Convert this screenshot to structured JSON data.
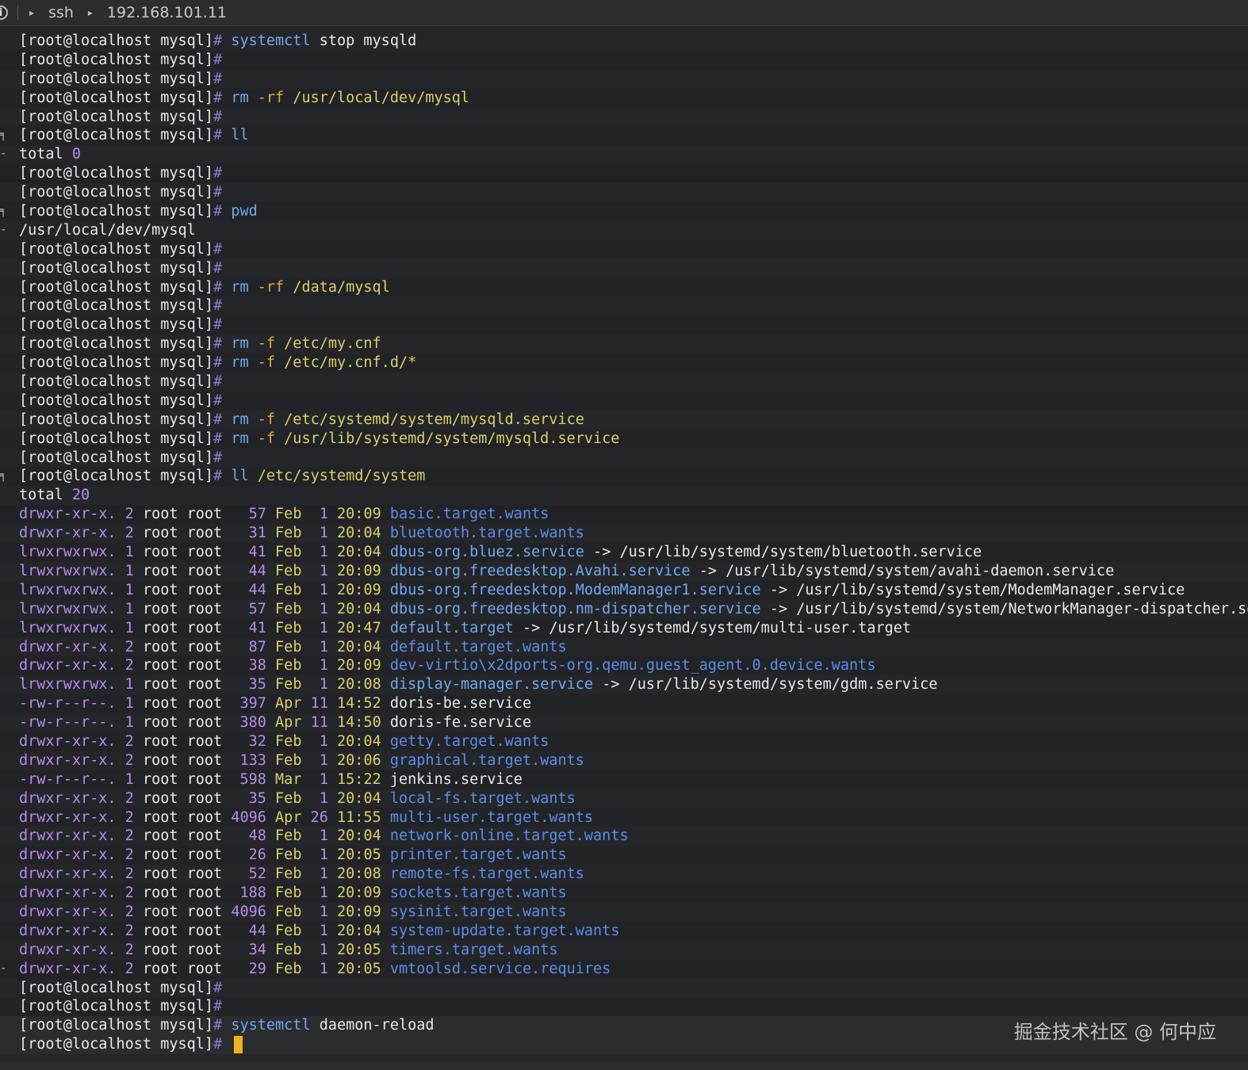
{
  "titlebar": {
    "arrow1": "▸",
    "item1": "ssh",
    "arrow2": "▸",
    "item2": "192.168.101.11"
  },
  "prompt": "[root@localhost mysql]",
  "hash": "#",
  "lines": [
    {
      "type": "cmd",
      "parts": [
        [
          "cmd",
          "systemctl"
        ],
        [
          "arg",
          " stop mysqld"
        ]
      ]
    },
    {
      "type": "cmd",
      "parts": []
    },
    {
      "type": "cmd",
      "parts": []
    },
    {
      "type": "cmd",
      "parts": [
        [
          "cmd",
          "rm"
        ],
        [
          "flag",
          " -rf"
        ],
        [
          "path",
          " /usr/local/dev/mysql"
        ]
      ]
    },
    {
      "type": "cmd",
      "parts": []
    },
    {
      "type": "cmd",
      "gutter": "╕",
      "parts": [
        [
          "cmd",
          "ll"
        ]
      ]
    },
    {
      "type": "out",
      "gutter": "-",
      "parts": [
        [
          "arg",
          "total "
        ],
        [
          "num",
          "0"
        ]
      ]
    },
    {
      "type": "cmd",
      "parts": []
    },
    {
      "type": "cmd",
      "parts": []
    },
    {
      "type": "cmd",
      "gutter": "╕",
      "parts": [
        [
          "cmd",
          "pwd"
        ]
      ]
    },
    {
      "type": "out",
      "gutter": "-",
      "parts": [
        [
          "arg",
          "/usr/local/dev/mysql"
        ]
      ]
    },
    {
      "type": "cmd",
      "parts": []
    },
    {
      "type": "cmd",
      "parts": []
    },
    {
      "type": "cmd",
      "parts": [
        [
          "cmd",
          "rm"
        ],
        [
          "flag",
          " -rf"
        ],
        [
          "path",
          " /data/mysql"
        ]
      ]
    },
    {
      "type": "cmd",
      "parts": []
    },
    {
      "type": "cmd",
      "parts": []
    },
    {
      "type": "cmd",
      "parts": [
        [
          "cmd",
          "rm"
        ],
        [
          "flag",
          " -f"
        ],
        [
          "path",
          " /etc/my.cnf"
        ]
      ]
    },
    {
      "type": "cmd",
      "parts": [
        [
          "cmd",
          "rm"
        ],
        [
          "flag",
          " -f"
        ],
        [
          "path",
          " /etc/my.cnf.d/*"
        ]
      ]
    },
    {
      "type": "cmd",
      "parts": []
    },
    {
      "type": "cmd",
      "parts": []
    },
    {
      "type": "cmd",
      "parts": [
        [
          "cmd",
          "rm"
        ],
        [
          "flag",
          " -f"
        ],
        [
          "path",
          " /etc/systemd/system/mysqld.service"
        ]
      ]
    },
    {
      "type": "cmd",
      "parts": [
        [
          "cmd",
          "rm"
        ],
        [
          "flag",
          " -f"
        ],
        [
          "path",
          " /usr/lib/systemd/system/mysqld.service"
        ]
      ]
    },
    {
      "type": "cmd",
      "parts": []
    },
    {
      "type": "cmd",
      "gutter": "╕",
      "parts": [
        [
          "cmd",
          "ll"
        ],
        [
          "path",
          " /etc/systemd/system"
        ]
      ]
    },
    {
      "type": "out",
      "parts": [
        [
          "arg",
          "total "
        ],
        [
          "num",
          "20"
        ]
      ]
    }
  ],
  "listing": [
    {
      "perm": "drwxr-xr-x.",
      "links": "2",
      "user": "root",
      "group": "root",
      "size": "  57",
      "mon": "Feb",
      "day": " 1",
      "time": "20:09",
      "name": "basic.target.wants",
      "kind": "dir",
      "target": ""
    },
    {
      "perm": "drwxr-xr-x.",
      "links": "2",
      "user": "root",
      "group": "root",
      "size": "  31",
      "mon": "Feb",
      "day": " 1",
      "time": "20:04",
      "name": "bluetooth.target.wants",
      "kind": "dir",
      "target": ""
    },
    {
      "perm": "lrwxrwxrwx.",
      "links": "1",
      "user": "root",
      "group": "root",
      "size": "  41",
      "mon": "Feb",
      "day": " 1",
      "time": "20:04",
      "name": "dbus-org.bluez.service",
      "kind": "link",
      "target": "/usr/lib/systemd/system/bluetooth.service"
    },
    {
      "perm": "lrwxrwxrwx.",
      "links": "1",
      "user": "root",
      "group": "root",
      "size": "  44",
      "mon": "Feb",
      "day": " 1",
      "time": "20:09",
      "name": "dbus-org.freedesktop.Avahi.service",
      "kind": "link",
      "target": "/usr/lib/systemd/system/avahi-daemon.service"
    },
    {
      "perm": "lrwxrwxrwx.",
      "links": "1",
      "user": "root",
      "group": "root",
      "size": "  44",
      "mon": "Feb",
      "day": " 1",
      "time": "20:09",
      "name": "dbus-org.freedesktop.ModemManager1.service",
      "kind": "link",
      "target": "/usr/lib/systemd/system/ModemManager.service"
    },
    {
      "perm": "lrwxrwxrwx.",
      "links": "1",
      "user": "root",
      "group": "root",
      "size": "  57",
      "mon": "Feb",
      "day": " 1",
      "time": "20:04",
      "name": "dbus-org.freedesktop.nm-dispatcher.service",
      "kind": "link",
      "target": "/usr/lib/systemd/system/NetworkManager-dispatcher.service"
    },
    {
      "perm": "lrwxrwxrwx.",
      "links": "1",
      "user": "root",
      "group": "root",
      "size": "  41",
      "mon": "Feb",
      "day": " 1",
      "time": "20:47",
      "name": "default.target",
      "kind": "link",
      "target": "/usr/lib/systemd/system/multi-user.target"
    },
    {
      "perm": "drwxr-xr-x.",
      "links": "2",
      "user": "root",
      "group": "root",
      "size": "  87",
      "mon": "Feb",
      "day": " 1",
      "time": "20:04",
      "name": "default.target.wants",
      "kind": "dir",
      "target": ""
    },
    {
      "perm": "drwxr-xr-x.",
      "links": "2",
      "user": "root",
      "group": "root",
      "size": "  38",
      "mon": "Feb",
      "day": " 1",
      "time": "20:09",
      "name": "dev-virtio\\x2dports-org.qemu.guest_agent.0.device.wants",
      "kind": "dir",
      "target": ""
    },
    {
      "perm": "lrwxrwxrwx.",
      "links": "1",
      "user": "root",
      "group": "root",
      "size": "  35",
      "mon": "Feb",
      "day": " 1",
      "time": "20:08",
      "name": "display-manager.service",
      "kind": "link",
      "target": "/usr/lib/systemd/system/gdm.service"
    },
    {
      "perm": "-rw-r--r--.",
      "links": "1",
      "user": "root",
      "group": "root",
      "size": " 397",
      "mon": "Apr",
      "day": "11",
      "time": "14:52",
      "name": "doris-be.service",
      "kind": "file",
      "target": ""
    },
    {
      "perm": "-rw-r--r--.",
      "links": "1",
      "user": "root",
      "group": "root",
      "size": " 380",
      "mon": "Apr",
      "day": "11",
      "time": "14:50",
      "name": "doris-fe.service",
      "kind": "file",
      "target": ""
    },
    {
      "perm": "drwxr-xr-x.",
      "links": "2",
      "user": "root",
      "group": "root",
      "size": "  32",
      "mon": "Feb",
      "day": " 1",
      "time": "20:04",
      "name": "getty.target.wants",
      "kind": "dir",
      "target": ""
    },
    {
      "perm": "drwxr-xr-x.",
      "links": "2",
      "user": "root",
      "group": "root",
      "size": " 133",
      "mon": "Feb",
      "day": " 1",
      "time": "20:06",
      "name": "graphical.target.wants",
      "kind": "dir",
      "target": ""
    },
    {
      "perm": "-rw-r--r--.",
      "links": "1",
      "user": "root",
      "group": "root",
      "size": " 598",
      "mon": "Mar",
      "day": " 1",
      "time": "15:22",
      "name": "jenkins.service",
      "kind": "file",
      "target": ""
    },
    {
      "perm": "drwxr-xr-x.",
      "links": "2",
      "user": "root",
      "group": "root",
      "size": "  35",
      "mon": "Feb",
      "day": " 1",
      "time": "20:04",
      "name": "local-fs.target.wants",
      "kind": "dir",
      "target": ""
    },
    {
      "perm": "drwxr-xr-x.",
      "links": "2",
      "user": "root",
      "group": "root",
      "size": "4096",
      "mon": "Apr",
      "day": "26",
      "time": "11:55",
      "name": "multi-user.target.wants",
      "kind": "dir",
      "target": ""
    },
    {
      "perm": "drwxr-xr-x.",
      "links": "2",
      "user": "root",
      "group": "root",
      "size": "  48",
      "mon": "Feb",
      "day": " 1",
      "time": "20:04",
      "name": "network-online.target.wants",
      "kind": "dir",
      "target": ""
    },
    {
      "perm": "drwxr-xr-x.",
      "links": "2",
      "user": "root",
      "group": "root",
      "size": "  26",
      "mon": "Feb",
      "day": " 1",
      "time": "20:05",
      "name": "printer.target.wants",
      "kind": "dir",
      "target": ""
    },
    {
      "perm": "drwxr-xr-x.",
      "links": "2",
      "user": "root",
      "group": "root",
      "size": "  52",
      "mon": "Feb",
      "day": " 1",
      "time": "20:08",
      "name": "remote-fs.target.wants",
      "kind": "dir",
      "target": ""
    },
    {
      "perm": "drwxr-xr-x.",
      "links": "2",
      "user": "root",
      "group": "root",
      "size": " 188",
      "mon": "Feb",
      "day": " 1",
      "time": "20:09",
      "name": "sockets.target.wants",
      "kind": "dir",
      "target": ""
    },
    {
      "perm": "drwxr-xr-x.",
      "links": "2",
      "user": "root",
      "group": "root",
      "size": "4096",
      "mon": "Feb",
      "day": " 1",
      "time": "20:09",
      "name": "sysinit.target.wants",
      "kind": "dir",
      "target": ""
    },
    {
      "perm": "drwxr-xr-x.",
      "links": "2",
      "user": "root",
      "group": "root",
      "size": "  44",
      "mon": "Feb",
      "day": " 1",
      "time": "20:04",
      "name": "system-update.target.wants",
      "kind": "dir",
      "target": ""
    },
    {
      "perm": "drwxr-xr-x.",
      "links": "2",
      "user": "root",
      "group": "root",
      "size": "  34",
      "mon": "Feb",
      "day": " 1",
      "time": "20:05",
      "name": "timers.target.wants",
      "kind": "dir",
      "target": ""
    },
    {
      "perm": "drwxr-xr-x.",
      "links": "2",
      "user": "root",
      "group": "root",
      "size": "  29",
      "mon": "Feb",
      "day": " 1",
      "time": "20:05",
      "name": "vmtoolsd.service.requires",
      "kind": "dir",
      "target": ""
    }
  ],
  "tail": [
    {
      "type": "cmd",
      "parts": []
    },
    {
      "type": "cmd",
      "parts": []
    },
    {
      "type": "cmd",
      "parts": [
        [
          "cmd",
          "systemctl"
        ],
        [
          "arg",
          " daemon-reload"
        ]
      ]
    },
    {
      "type": "cmd",
      "parts": [],
      "cursor": true
    }
  ],
  "link_arrow": " -> ",
  "watermark": "掘金技术社区 @ 何中应",
  "colors": {
    "background": "#25262a",
    "cursor": "#f0b020",
    "dir": "#5a8ee8",
    "command": "#6fa8f0"
  }
}
